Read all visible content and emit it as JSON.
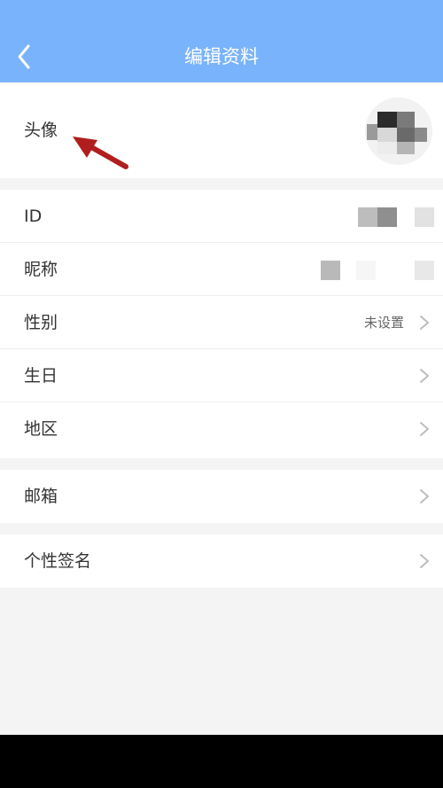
{
  "header": {
    "title": "编辑资料"
  },
  "avatar_row": {
    "label": "头像"
  },
  "info_rows": [
    {
      "label": "ID",
      "value": ""
    },
    {
      "label": "昵称",
      "value": ""
    },
    {
      "label": "性别",
      "value": "未设置"
    },
    {
      "label": "生日",
      "value": ""
    },
    {
      "label": "地区",
      "value": ""
    }
  ],
  "email_row": {
    "label": "邮箱"
  },
  "signature_row": {
    "label": "个性签名"
  },
  "icons": {
    "back": "back-arrow-icon",
    "chevron": "chevron-right-icon",
    "annotation": "red-annotation-arrow"
  },
  "colors": {
    "header_bg": "#79b3fb",
    "page_bg": "#f4f4f4",
    "annotation_red": "#b01e1e"
  }
}
